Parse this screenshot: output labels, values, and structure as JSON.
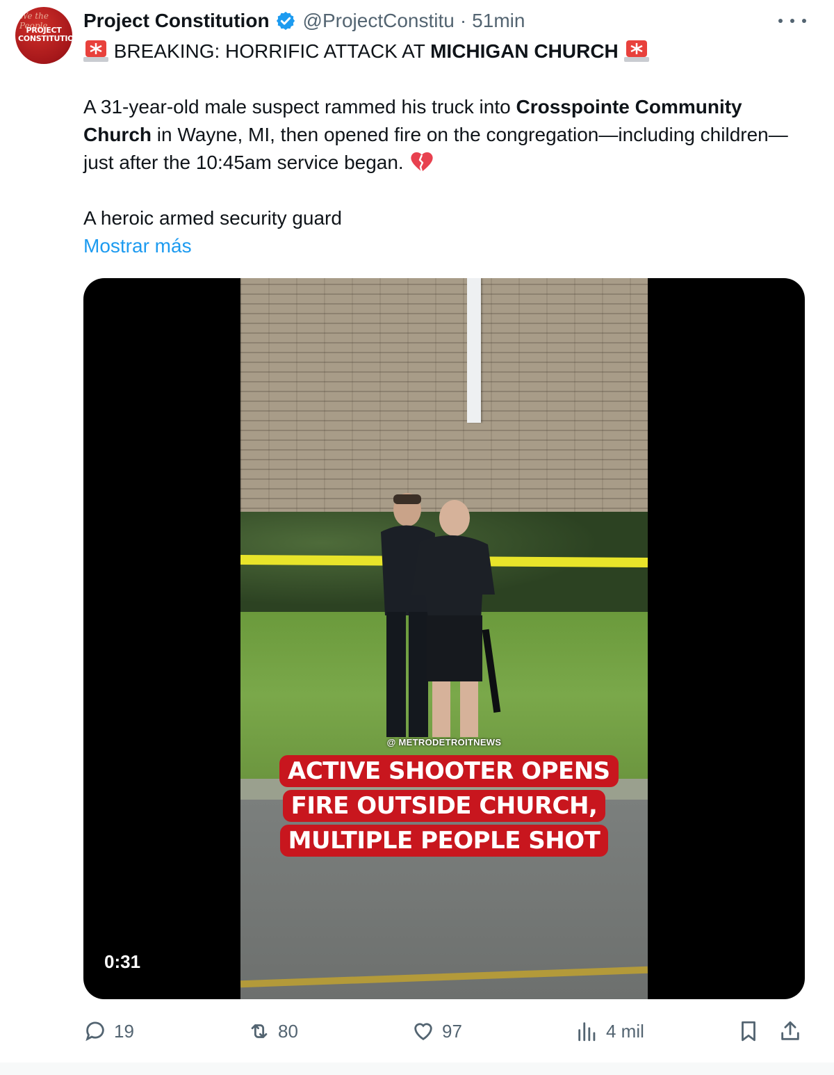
{
  "tweet": {
    "author_name": "Project Constitution",
    "handle": "@ProjectConstitu",
    "separator": "·",
    "time": "51min",
    "avatar_text": "PROJECT CONSTITUTION",
    "avatar_script": "We the People",
    "headline_pre": "BREAKING: HORRIFIC ATTACK AT ",
    "headline_bold": "MICHIGAN CHURCH",
    "para1_a": "A 31-year-old male suspect rammed his truck into ",
    "para1_b": "Crosspointe Community Church",
    "para1_c": " in Wayne, MI, then opened fire on the congregation—including children—just after the 10:45am service began. ",
    "para2": "A heroic armed security guard",
    "show_more": "Mostrar más"
  },
  "video": {
    "watermark": "@ METRODETROITNEWS",
    "caption_lines": [
      "ACTIVE SHOOTER OPENS",
      "FIRE OUTSIDE CHURCH,",
      "MULTIPLE PEOPLE SHOT"
    ],
    "duration": "0:31"
  },
  "actions": {
    "replies": "19",
    "reposts": "80",
    "likes": "97",
    "views": "4 mil"
  },
  "colors": {
    "link": "#1d9bf0",
    "secondary_text": "#536471",
    "caption_bg": "#c8161e",
    "verified": "#1d9bf0"
  },
  "icons": [
    "siren-icon",
    "broken-heart-icon",
    "verified-icon",
    "more-icon",
    "reply-icon",
    "repost-icon",
    "like-icon",
    "views-icon",
    "bookmark-icon",
    "share-icon"
  ]
}
